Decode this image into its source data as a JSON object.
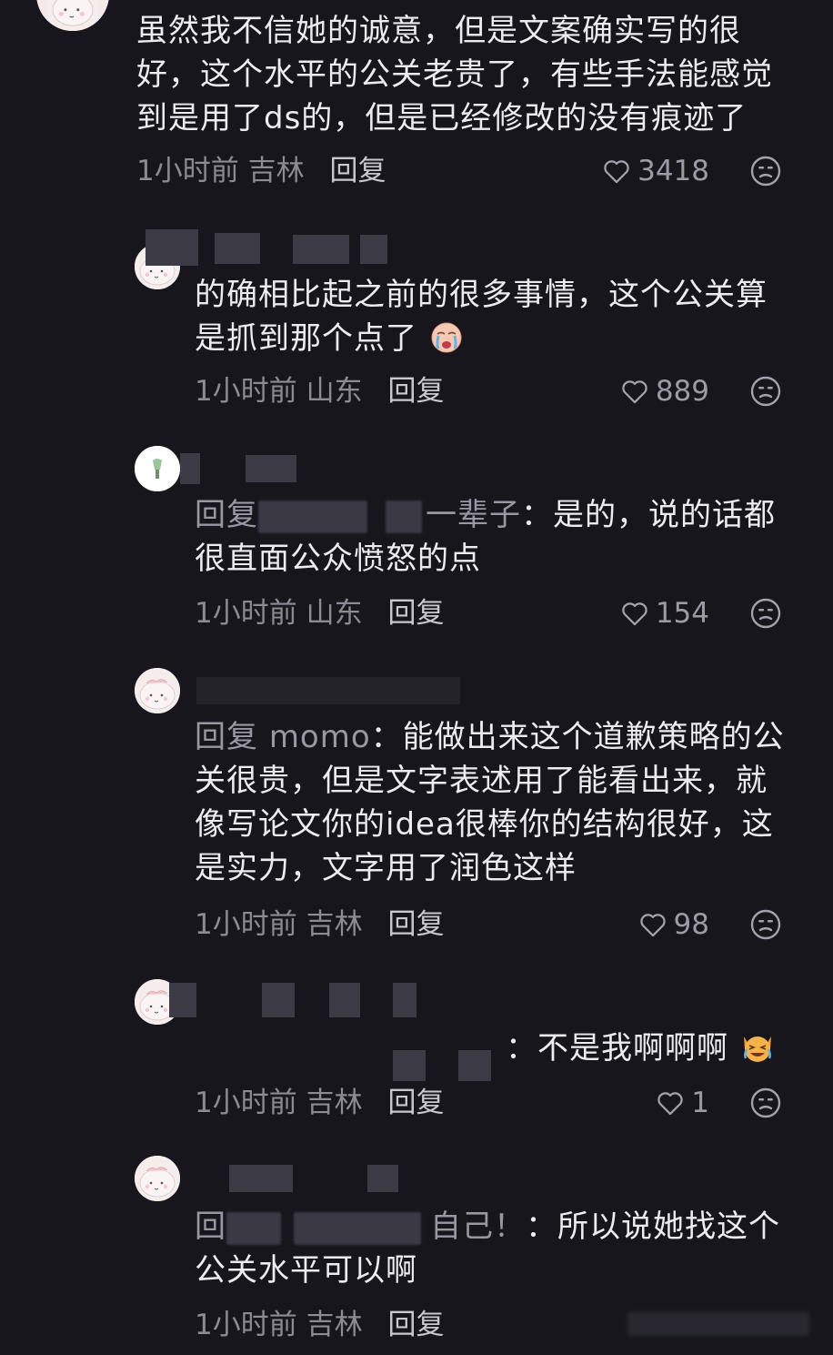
{
  "comments": [
    {
      "text": "虽然我不信她的诚意，但是文案确实写的很好，这个水平的公关老贵了，有些手法能感觉到是用了ds的，但是已经修改的没有痕迹了",
      "time": "1小时前",
      "location": "吉林",
      "reply_label": "回复",
      "likes": "3418"
    },
    {
      "text": "的确相比起之前的很多事情，这个公关算是抓到那个点了",
      "time": "1小时前",
      "location": "山东",
      "reply_label": "回复",
      "likes": "889"
    },
    {
      "reply_prefix": "回复",
      "reply_visible_end": "一辈子",
      "text": "：是的，说的话都很直面公众愤怒的点",
      "time": "1小时前",
      "location": "山东",
      "reply_label": "回复",
      "likes": "154"
    },
    {
      "reply_prefix": "回复",
      "reply_to": "momo",
      "text": "：能做出来这个道歉策略的公关很贵，但是文字表述用了能看出来，就像写论文你的idea很棒你的结构很好，这是实力，文字用了润色这样",
      "time": "1小时前",
      "location": "吉林",
      "reply_label": "回复",
      "likes": "98"
    },
    {
      "text": "：不是我啊啊啊",
      "time": "1小时前",
      "location": "吉林",
      "reply_label": "回复",
      "likes": "1"
    },
    {
      "reply_prefix": "回",
      "reply_visible_end": "自己！",
      "text": "：所以说她找这个公关水平可以啊",
      "time": "1小时前",
      "location": "吉林",
      "reply_label": "回复"
    }
  ],
  "colors": {
    "background": "#17161d",
    "text": "#ecebf0",
    "meta": "#8c8a95",
    "blur": "#3a3944"
  },
  "icons": [
    "avatar-icon",
    "heart-icon",
    "dislike-face-icon",
    "crying-face-emoji",
    "laughing-cat-emoji"
  ]
}
